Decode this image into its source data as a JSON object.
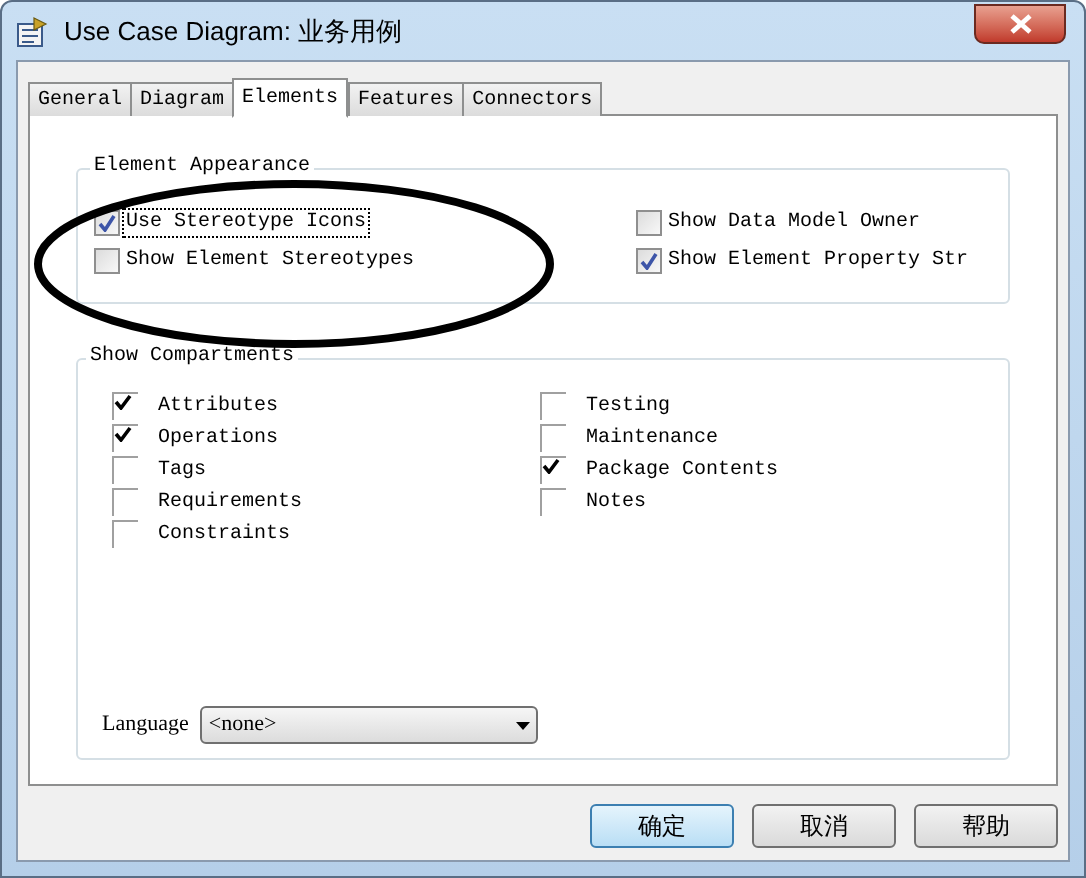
{
  "window": {
    "title": "Use Case Diagram: 业务用例"
  },
  "tabs": [
    {
      "label": "General",
      "selected": false
    },
    {
      "label": "Diagram",
      "selected": false
    },
    {
      "label": "Elements",
      "selected": true
    },
    {
      "label": "Features",
      "selected": false
    },
    {
      "label": "Connectors",
      "selected": false
    }
  ],
  "element_appearance": {
    "title": "Element Appearance",
    "options": [
      {
        "label": "Use Stereotype Icons",
        "checked": true,
        "focused": true
      },
      {
        "label": "Show Data Model Owner",
        "checked": false,
        "focused": false
      },
      {
        "label": "Show Element Stereotypes",
        "checked": false,
        "focused": false
      },
      {
        "label": "Show Element Property Str",
        "checked": true,
        "focused": false
      }
    ]
  },
  "show_compartments": {
    "title": "Show Compartments",
    "columns": [
      [
        {
          "label": "Attributes",
          "checked": true
        },
        {
          "label": "Operations",
          "checked": true
        },
        {
          "label": "Tags",
          "checked": false
        },
        {
          "label": "Requirements",
          "checked": false
        },
        {
          "label": "Constraints",
          "checked": false
        }
      ],
      [
        {
          "label": "Testing",
          "checked": false
        },
        {
          "label": "Maintenance",
          "checked": false
        },
        {
          "label": "Package Contents",
          "checked": true
        },
        {
          "label": "Notes",
          "checked": false
        }
      ]
    ],
    "language": {
      "label": "Language",
      "value": "<none>"
    }
  },
  "buttons": [
    {
      "label": "确定",
      "default": true
    },
    {
      "label": "取消",
      "default": false
    },
    {
      "label": "帮助",
      "default": false
    }
  ]
}
